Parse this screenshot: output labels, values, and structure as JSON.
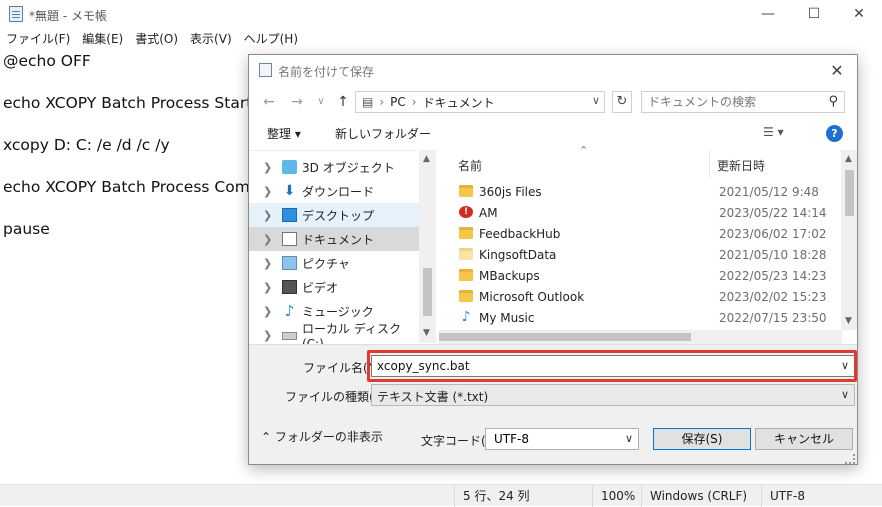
{
  "notepad": {
    "title": "*無題 - メモ帳",
    "menu": [
      "ファイル(F)",
      "編集(E)",
      "書式(O)",
      "表示(V)",
      "ヘルプ(H)"
    ],
    "lines": [
      "@echo OFF",
      "echo XCOPY Batch Process Start",
      "xcopy D: C: /e /d /c /y",
      "echo XCOPY Batch Process Com",
      "pause"
    ],
    "status": {
      "position": "5 行、24 列",
      "zoom": "100%",
      "line_ending": "Windows (CRLF)",
      "encoding": "UTF-8"
    }
  },
  "dialog": {
    "title": "名前を付けて保存",
    "address": [
      "PC",
      "ドキュメント"
    ],
    "search_placeholder": "ドキュメントの検索",
    "toolbar": {
      "organize": "整理 ▾",
      "new_folder": "新しいフォルダー"
    },
    "tree": [
      "3D オブジェクト",
      "ダウンロード",
      "デスクトップ",
      "ドキュメント",
      "ピクチャ",
      "ビデオ",
      "ミュージック",
      "ローカル ディスク (C:)"
    ],
    "columns": {
      "name": "名前",
      "modified": "更新日時"
    },
    "files": [
      {
        "name": "360js Files",
        "date": "2021/05/12 9:48",
        "icon": "folder"
      },
      {
        "name": "AM",
        "date": "2023/05/22 14:14",
        "icon": "warning-folder"
      },
      {
        "name": "FeedbackHub",
        "date": "2023/06/02 17:02",
        "icon": "folder"
      },
      {
        "name": "KingsoftData",
        "date": "2021/05/10 18:28",
        "icon": "folder-pale"
      },
      {
        "name": "MBackups",
        "date": "2022/05/23 14:23",
        "icon": "folder"
      },
      {
        "name": "Microsoft Outlook",
        "date": "2023/02/02 15:23",
        "icon": "folder"
      },
      {
        "name": "My Music",
        "date": "2022/07/15 23:50",
        "icon": "music-folder"
      }
    ],
    "filename_label": "ファイル名(N):",
    "filename_value": "xcopy_sync.bat",
    "filetype_label": "ファイルの種類(T):",
    "filetype_value": "テキスト文書 (*.txt)",
    "hide_folders": "フォルダーの非表示",
    "encoding_label": "文字コード(E):",
    "encoding_value": "UTF-8",
    "save": "保存(S)",
    "cancel": "キャンセル",
    "highlight_color": "#e03a2f"
  }
}
